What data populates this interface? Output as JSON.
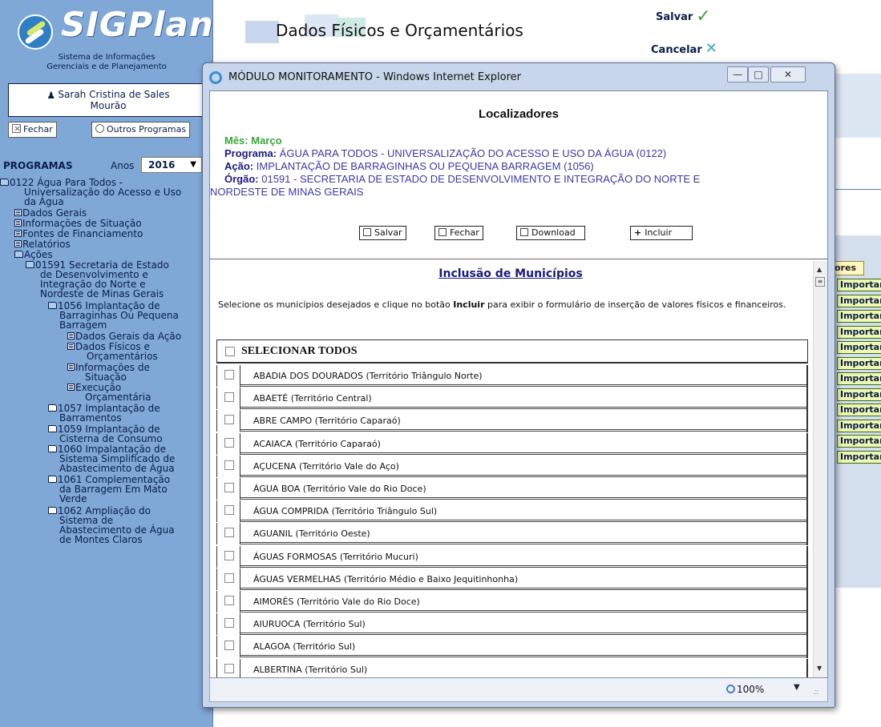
{
  "sidebar": {
    "logo_name": "SIGPlan",
    "logo_sub_line1": "Sistema de Informações",
    "logo_sub_line2": "Gerenciais e de Planejamento",
    "user_line1": "Sarah Cristina de Sales",
    "user_line2": "Mourão",
    "close_button": "Fechar",
    "other_programs_button": "Outros Programas",
    "programas_label": "PROGRAMAS",
    "anos_label": "Anos",
    "year": "2016",
    "tree": [
      {
        "icon": "folder-open",
        "lines": [
          "0122 Água Para Todos -",
          "Universalização do Acesso e Uso",
          "da Água"
        ]
      },
      {
        "icon": "doc",
        "lines": [
          "Dados Gerais"
        ]
      },
      {
        "icon": "doc",
        "lines": [
          "Informações de Situação"
        ]
      },
      {
        "icon": "doc",
        "lines": [
          "Fontes de Financiamento"
        ]
      },
      {
        "icon": "doc",
        "lines": [
          "Relatórios"
        ]
      },
      {
        "icon": "folder-open",
        "lines": [
          "Ações"
        ]
      },
      {
        "icon": "folder-open",
        "lines": [
          "01591 Secretaria de Estado",
          "de Desenvolvimento e",
          "Integração do Norte e",
          "Nordeste de Minas Gerais"
        ]
      },
      {
        "icon": "folder-open",
        "lines": [
          "1056 Implantação de",
          "Barraginhas Ou Pequena",
          "Barragem"
        ]
      },
      {
        "icon": "doc",
        "lines": [
          "Dados Gerais da Ação"
        ]
      },
      {
        "icon": "doc",
        "lines": [
          "Dados Físicos e",
          "Orçamentários"
        ]
      },
      {
        "icon": "doc",
        "lines": [
          "Informações de",
          "Situação"
        ]
      },
      {
        "icon": "doc",
        "lines": [
          "Execução",
          "Orçamentária"
        ]
      },
      {
        "icon": "folder-closed",
        "lines": [
          "1057 Implantação de",
          "Barramentos"
        ]
      },
      {
        "icon": "folder-closed",
        "lines": [
          "1059 Implantação de",
          "Cisterna de Consumo"
        ]
      },
      {
        "icon": "folder-closed",
        "lines": [
          "1060 Impalantação de",
          "Sistema Simplificado de",
          "Abastecimento de Água"
        ]
      },
      {
        "icon": "folder-closed",
        "lines": [
          "1061 Complementação",
          "da Barragem Em Mato",
          "Verde"
        ]
      },
      {
        "icon": "folder-closed",
        "lines": [
          "1062 Ampliação do",
          "Sistema de",
          "Abastecimento de Água",
          "de Montes Claros"
        ]
      }
    ]
  },
  "header": {
    "title": "Dados Físicos e Orçamentários",
    "save_label": "Salvar",
    "cancel_label": "Cancelar"
  },
  "background": {
    "column_header": "ores",
    "import_label": "Importar",
    "import_count": 12
  },
  "popup": {
    "window_title": "MÓDULO MONITORAMENTO - Windows Internet Explorer",
    "heading": "Localizadores",
    "mes_label": "Mês:",
    "mes_value": "Março",
    "programa_label": "Programa:",
    "programa_value": "ÁGUA PARA TODOS - UNIVERSALIZAÇÃO DO ACESSO E USO DA ÁGUA (0122)",
    "acao_label": "Ação:",
    "acao_value": "IMPLANTAÇÃO DE BARRAGINHAS OU PEQUENA BARRAGEM (1056)",
    "orgao_label": "Órgão:",
    "orgao_value_line1": "01591 - SECRETARIA DE ESTADO DE DESENVOLVIMENTO E INTEGRAÇÃO DO NORTE E",
    "orgao_value_line2": "NORDESTE DE MINAS GERAIS",
    "toolbar": {
      "save": "Salvar",
      "close": "Fechar",
      "download": "Download",
      "include": "Incluir"
    },
    "inclusion_title": "Inclusão de Municípios",
    "description_pre": "Selecione os municípios desejados e clique no botão ",
    "description_bold": "Incluir",
    "description_post": " para exibir o formulário de inserção de valores físicos e financeiros.",
    "select_all": "SELECIONAR TODOS",
    "municipios": [
      "ABADIA DOS DOURADOS (Território Triângulo Norte)",
      "ABAETÉ (Território Central)",
      "ABRE CAMPO (Território Caparaó)",
      "ACAIACA (Território Caparaó)",
      "AÇUCENA (Território Vale do Aço)",
      "ÁGUA BOA (Território Vale do Rio Doce)",
      "ÁGUA COMPRIDA (Território Triângulo Sul)",
      "AGUANIL (Território Oeste)",
      "ÁGUAS FORMOSAS (Território Mucuri)",
      "ÁGUAS VERMELHAS (Território Médio e Baixo Jequitinhonha)",
      "AIMORÉS (Território Vale do Rio Doce)",
      "AIURUOCA (Território Sul)",
      "ALAGOA (Território Sul)",
      "ALBERTINA (Território Sul)"
    ],
    "zoom": "100%"
  }
}
